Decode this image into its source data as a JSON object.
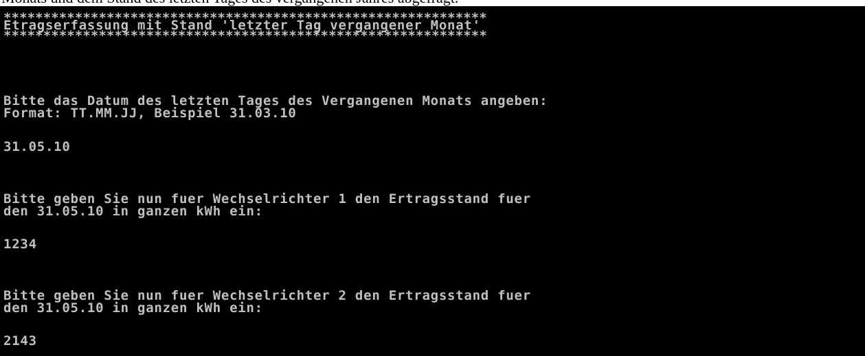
{
  "document": {
    "cut_text": "Monats und dem Stand des letzten Tages des vergangenen Jahres abgefragt."
  },
  "console": {
    "colors": {
      "background": "#000000",
      "text": "#c0c0c0"
    },
    "banner": {
      "stars_top": "*************************************************************",
      "title": "Etragserfassung mit Stand 'letzter Tag vergangener Monat'",
      "stars_bottom": "*************************************************************"
    },
    "prompt_date": {
      "line1": "Bitte das Datum des letzten Tages des Vergangenen Monats angeben:",
      "line2": "Format: TT.MM.JJ, Beispiel 31.03.10"
    },
    "input_date": "31.05.10",
    "prompt_inverter1": {
      "line1": "Bitte geben Sie nun fuer Wechselrichter 1 den Ertragsstand fuer",
      "line2": "den 31.05.10 in ganzen kWh ein:"
    },
    "input_inverter1": "1234",
    "prompt_inverter2": {
      "line1": "Bitte geben Sie nun fuer Wechselrichter 2 den Ertragsstand fuer",
      "line2": "den 31.05.10 in ganzen kWh ein:"
    },
    "input_inverter2": "2143"
  }
}
